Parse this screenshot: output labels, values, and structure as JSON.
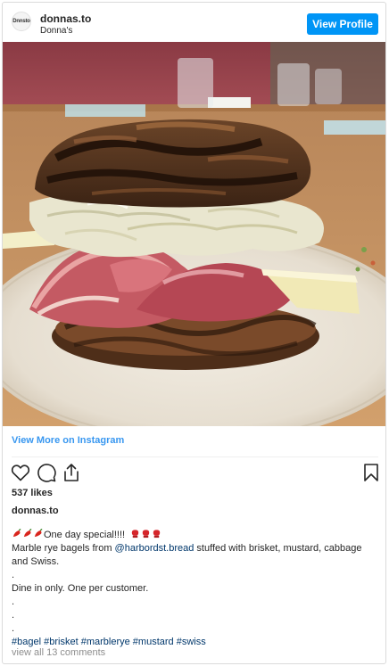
{
  "header": {
    "avatar_text": "Dnnsto",
    "username": "donnas.to",
    "subtitle": "Donna's",
    "view_profile_label": "View Profile"
  },
  "photo": {
    "description_icon": "bagel-sandwich-photo"
  },
  "view_more_label": "View More on Instagram",
  "actions": {
    "like_icon": "heart-icon",
    "comment_icon": "comment-icon",
    "share_icon": "share-icon",
    "save_icon": "bookmark-icon"
  },
  "likes": "537 likes",
  "owner": "donnas.to",
  "caption": {
    "line1_text": "One day special!!!!",
    "line2_pre": "Marble rye bagels from ",
    "line2_mention": "@harbordst.bread",
    "line2_post": " stuffed with brisket, mustard, cabbage",
    "line3": "and Swiss.",
    "dot": ".",
    "line5": "Dine in only. One per customer.",
    "hashtags": [
      "#bagel",
      "#brisket",
      "#marblerye",
      "#mustard",
      "#swiss"
    ]
  },
  "comments_label": "view all 13 comments",
  "colors": {
    "accent": "#0095f6",
    "link": "#3897f0",
    "hashtag": "#00376b",
    "muted": "#8e8e8e"
  }
}
